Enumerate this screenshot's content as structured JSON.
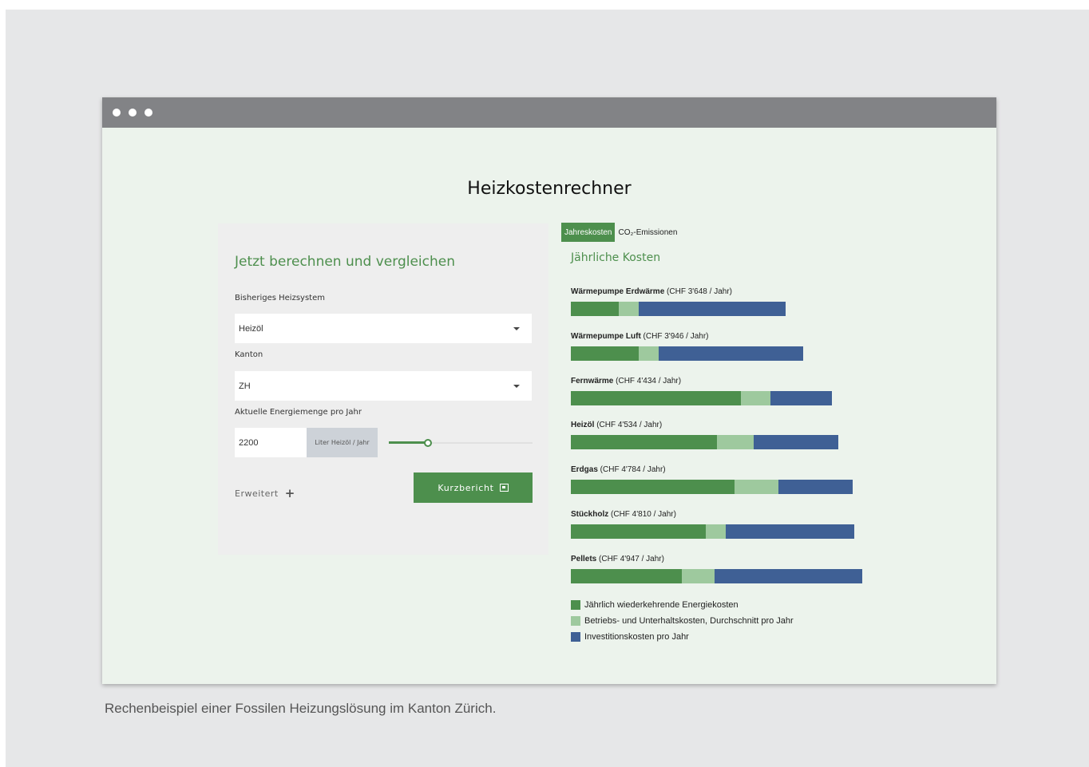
{
  "app": {
    "title": "Heizkostenrechner"
  },
  "form": {
    "heading": "Jetzt berechnen und vergleichen",
    "heating_label": "Bisheriges Heizsystem",
    "heating_value": "Heizöl",
    "canton_label": "Kanton",
    "canton_value": "ZH",
    "energy_label": "Aktuelle Energiemenge pro Jahr",
    "energy_value": "2200",
    "energy_unit": "Liter Heizöl / Jahr",
    "slider_fraction": 0.27,
    "advanced_label": "Erweitert",
    "report_button": "Kurzbericht"
  },
  "tabs": [
    {
      "label": "Jahreskosten",
      "active": true
    },
    {
      "label": "CO₂-Emissionen",
      "active": false
    }
  ],
  "chart_heading": "Jährliche Kosten",
  "chart_data": {
    "type": "bar",
    "orientation": "horizontal",
    "stacked": true,
    "legend_position": "bottom",
    "categories": [
      "Wärmepumpe Erdwärme",
      "Wärmepumpe Luft",
      "Fernwärme",
      "Heizöl",
      "Erdgas",
      "Stückholz",
      "Pellets"
    ],
    "category_notes": [
      "(CHF 3'648 / Jahr)",
      "(CHF 3'946 / Jahr)",
      "(CHF 4'434 / Jahr)",
      "(CHF 4'534 / Jahr)",
      "(CHF 4'784 / Jahr)",
      "(CHF 4'810 / Jahr)",
      "(CHF 4'947 / Jahr)"
    ],
    "series": [
      {
        "name": "Jährlich wiederkehrende Energiekosten",
        "color": "#4d8f4d",
        "values": [
          810,
          1150,
          2880,
          2480,
          2780,
          2290,
          1880
        ]
      },
      {
        "name": "Betriebs- und Unterhaltskosten, Durchschnitt pro Jahr",
        "color": "#9ec99e",
        "values": [
          340,
          340,
          510,
          620,
          740,
          340,
          560
        ]
      },
      {
        "name": "Investitionskosten pro Jahr",
        "color": "#3f6095",
        "values": [
          2498,
          2456,
          1044,
          1434,
          1264,
          2180,
          2507
        ]
      }
    ]
  },
  "caption": "Rechenbeispiel einer Fossilen Heizungslösung im Kanton Zürich."
}
